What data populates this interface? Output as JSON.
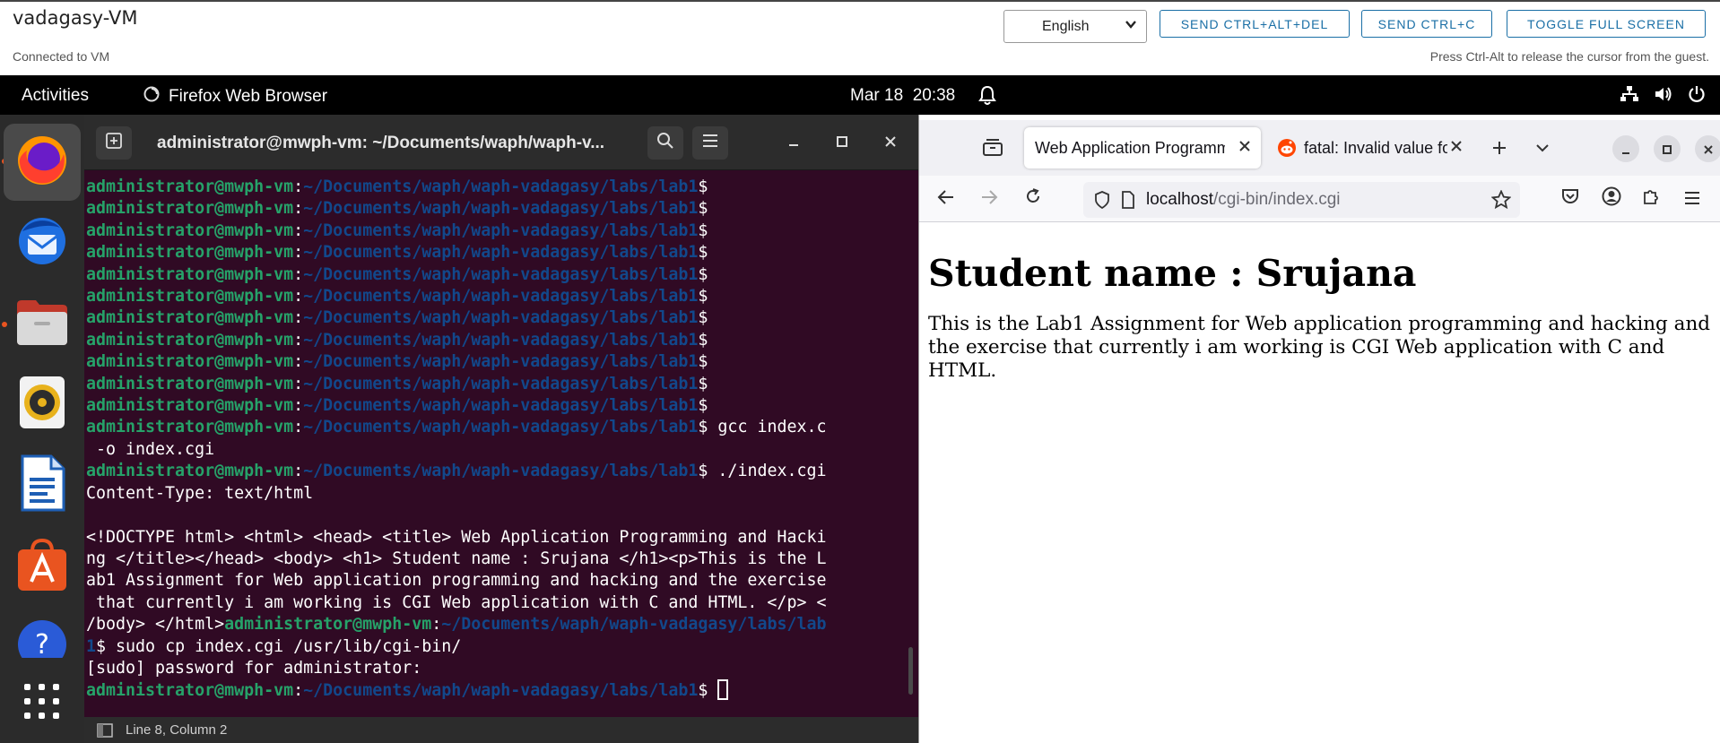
{
  "vm": {
    "title": "vadagasy-VM",
    "status": "Connected to VM",
    "hint": "Press Ctrl-Alt to release the cursor from the guest.",
    "language": "English",
    "buttons": [
      "SEND CTRL+ALT+DEL",
      "SEND CTRL+C",
      "TOGGLE FULL SCREEN"
    ]
  },
  "topbar": {
    "activities": "Activities",
    "app": "Firefox Web Browser",
    "date": "Mar 18",
    "time": "20:38"
  },
  "dock": {
    "items": [
      "firefox-icon",
      "thunderbird-icon",
      "files-icon",
      "rhythmbox-icon",
      "writer-icon",
      "app-center-icon",
      "help-icon",
      "show-apps-icon"
    ]
  },
  "terminal": {
    "title": "administrator@mwph-vm: ~/Documents/waph/waph-v...",
    "user": "administrator@mwph-vm",
    "colon": ":",
    "path": "~/Documents/waph/waph-vadagasy/labs/lab1",
    "path_wrap_a": "~/Documents/waph/waph-vadagasy/labs/lab",
    "path_wrap_b": "1",
    "prompt": "$",
    "cmd_gcc": " gcc index.c",
    "cmd_gcc_cont": " -o index.cgi",
    "cmd_run": " ./index.cgi",
    "out_content_type": "Content-Type: text/html",
    "out_html_1": "<!DOCTYPE html> <html> <head> <title> Web Application Programming and Hacki",
    "out_html_2": "ng </title></head> <body> <h1> Student name : Srujana </h1><p>This is the L",
    "out_html_3": "ab1 Assignment for Web application programming and hacking and the exercise",
    "out_html_4": " that currently i am working is CGI Web application with C and HTML. </p> <",
    "out_html_5": "/body> </html>",
    "cmd_cp": " sudo cp index.cgi /usr/lib/cgi-bin/",
    "out_sudo": "[sudo] password for administrator:",
    "status": "Line 8, Column 2"
  },
  "firefox": {
    "tabs": [
      {
        "label": "Web Application Programming and Hacking"
      },
      {
        "label": "fatal: Invalid value for"
      }
    ],
    "url_host": "localhost",
    "url_path": "/cgi-bin/index.cgi",
    "page": {
      "heading": "Student name : Srujana",
      "paragraph": "This is the Lab1 Assignment for Web application programming and hacking and the exercise that currently i am working is CGI Web application with C and HTML."
    }
  },
  "colors": {
    "terminal_bg": "#300a24",
    "prompt_user": "#26a269",
    "prompt_path": "#12488b",
    "ubuntu_orange": "#e95420",
    "vm_button": "#1a6fa6"
  }
}
